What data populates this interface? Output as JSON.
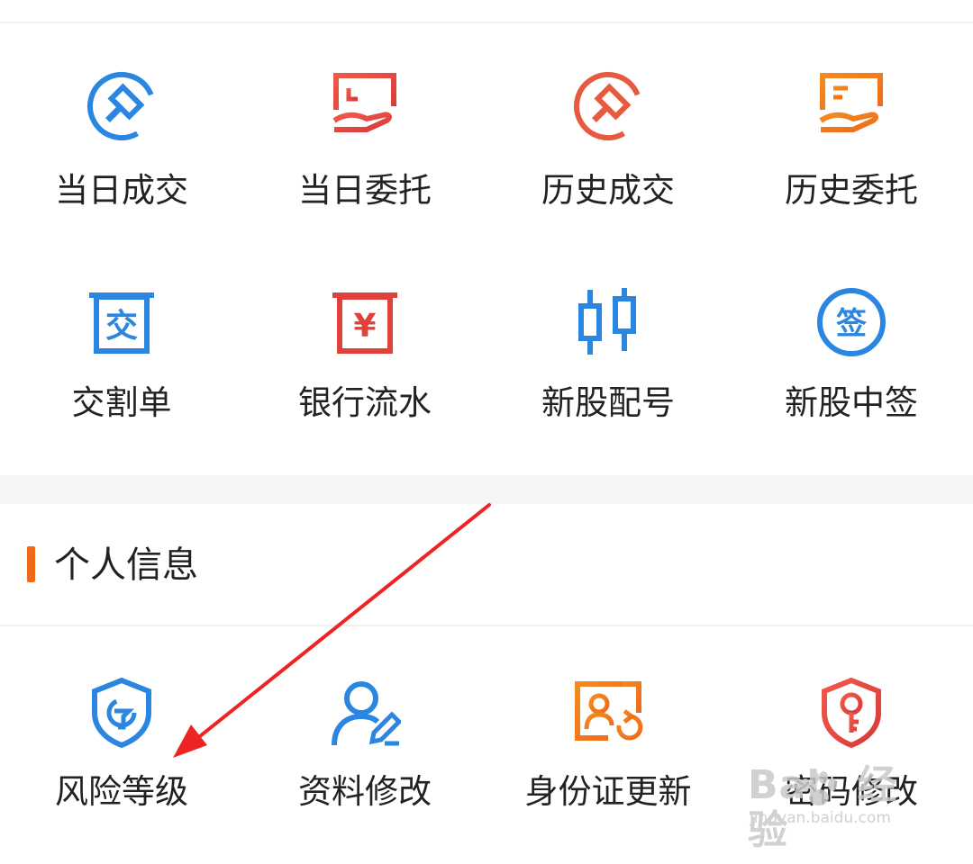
{
  "trade_grid": {
    "rows": [
      [
        {
          "label": "当日成交",
          "icon": "gavel-icon",
          "color": "#2a86e0"
        },
        {
          "label": "当日委托",
          "icon": "hand-document-icon",
          "color": "#e0413a"
        },
        {
          "label": "历史成交",
          "icon": "gavel-icon",
          "color": "#e65a3f"
        },
        {
          "label": "历史委托",
          "icon": "hand-document-icon",
          "color": "#f07a1a"
        }
      ],
      [
        {
          "label": "交割单",
          "icon": "delivery-slip-icon",
          "color": "#2a86e0"
        },
        {
          "label": "银行流水",
          "icon": "yuan-scroll-icon",
          "color": "#e0413a"
        },
        {
          "label": "新股配号",
          "icon": "candlestick-icon",
          "color": "#2a86e0"
        },
        {
          "label": "新股中签",
          "icon": "lottery-badge-icon",
          "color": "#2a86e0"
        }
      ]
    ]
  },
  "personal_info": {
    "title": "个人信息",
    "accent": "#ee6a1b",
    "items": [
      {
        "label": "风险等级",
        "icon": "shield-risk-icon",
        "color": "#2a86e0"
      },
      {
        "label": "资料修改",
        "icon": "user-edit-icon",
        "color": "#2a86e0"
      },
      {
        "label": "身份证更新",
        "icon": "id-card-refresh-icon",
        "color": "#f07a1a"
      },
      {
        "label": "密码修改",
        "icon": "shield-key-icon",
        "color": "#e0413a"
      }
    ]
  },
  "glyphs": {
    "delivery": "交",
    "yuan": "¥",
    "lottery": "签"
  },
  "watermark": {
    "brand": "Bai",
    "brand_tail": "经验",
    "url": "jingyan.baidu.com"
  }
}
